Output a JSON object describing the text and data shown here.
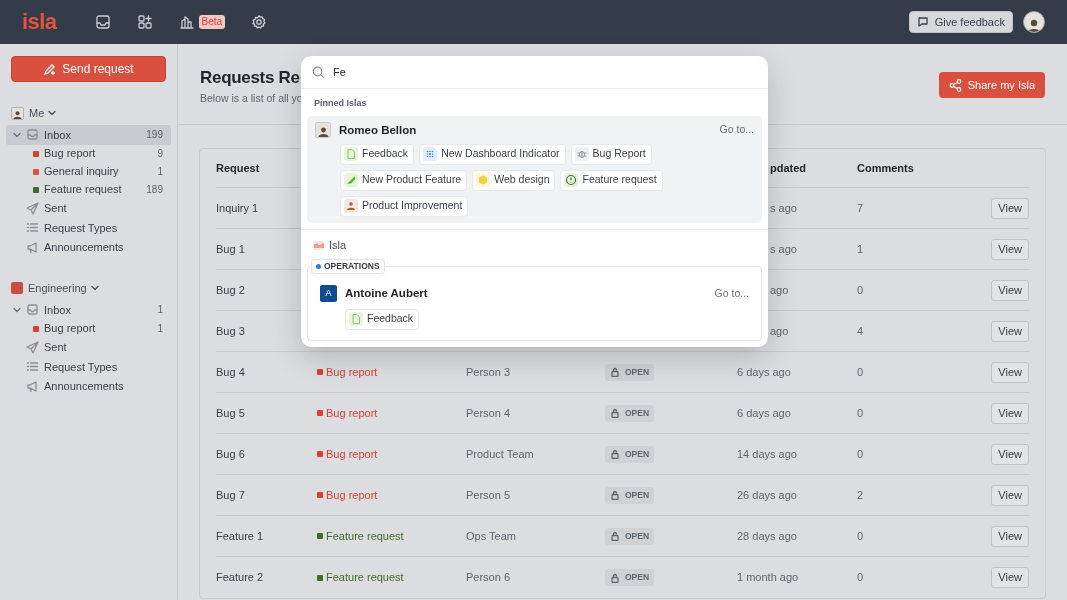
{
  "topbar": {
    "logo": "isla",
    "nav": [
      {
        "kind": "inbox"
      },
      {
        "kind": "apps"
      },
      {
        "kind": "analytics",
        "badge": "Beta"
      },
      {
        "kind": "settings"
      }
    ],
    "feedback_button": "Give feedback"
  },
  "sidebar": {
    "send_button": "Send request",
    "groups": [
      {
        "name": "Me",
        "kind": "person",
        "items": [
          {
            "kind": "inbox",
            "label": "Inbox",
            "count": "199",
            "selected": true,
            "expanded": true,
            "children": [
              {
                "label": "Bug report",
                "count": "9",
                "color": "#d9412f"
              },
              {
                "label": "General inquiry",
                "count": "1",
                "color": "#e2533f"
              },
              {
                "label": "Feature request",
                "count": "189",
                "color": "#3d6e28"
              }
            ]
          },
          {
            "kind": "sent",
            "label": "Sent"
          },
          {
            "kind": "types",
            "label": "Request Types"
          },
          {
            "kind": "announcements",
            "label": "Announcements"
          }
        ]
      },
      {
        "name": "Engineering",
        "kind": "team",
        "color": "#c9503f",
        "items": [
          {
            "kind": "inbox",
            "label": "Inbox",
            "count": "1",
            "selected": false,
            "expanded": true,
            "children": [
              {
                "label": "Bug report",
                "count": "1",
                "color": "#d9412f"
              }
            ]
          },
          {
            "kind": "sent",
            "label": "Sent"
          },
          {
            "kind": "types",
            "label": "Request Types"
          },
          {
            "kind": "announcements",
            "label": "Announcements"
          }
        ]
      }
    ]
  },
  "main": {
    "title": "Requests Re",
    "subtitle": "Below is a list of all yo",
    "share_button": "Share my Isla",
    "table": {
      "header": {
        "request": "Request",
        "updated": "pdated",
        "comments": "Comments"
      },
      "rows": [
        {
          "request": "Inquiry 1",
          "updated": "s ago",
          "comments": "7",
          "action": "View"
        },
        {
          "request": "Bug 1",
          "updated": "s ago",
          "comments": "1",
          "action": "View"
        },
        {
          "request": "Bug 2",
          "updated": "ago",
          "comments": "0",
          "action": "View"
        },
        {
          "request": "Bug 3",
          "updated": "ago",
          "comments": "4",
          "action": "View"
        },
        {
          "request": "Bug 4",
          "type": {
            "label": "Bug report",
            "color": "#d9412f"
          },
          "owner": "Person 3",
          "status": "OPEN",
          "updated": "6 days ago",
          "comments": "0",
          "action": "View"
        },
        {
          "request": "Bug 5",
          "type": {
            "label": "Bug report",
            "color": "#d9412f"
          },
          "owner": "Person 4",
          "status": "OPEN",
          "updated": "6 days ago",
          "comments": "0",
          "action": "View"
        },
        {
          "request": "Bug 6",
          "type": {
            "label": "Bug report",
            "color": "#d9412f"
          },
          "owner": "Product Team",
          "status": "OPEN",
          "updated": "14 days ago",
          "comments": "0",
          "action": "View"
        },
        {
          "request": "Bug 7",
          "type": {
            "label": "Bug report",
            "color": "#d9412f"
          },
          "owner": "Person 5",
          "status": "OPEN",
          "updated": "26 days ago",
          "comments": "2",
          "action": "View"
        },
        {
          "request": "Feature 1",
          "type": {
            "label": "Feature request",
            "color": "#3d6e28"
          },
          "owner": "Ops Team",
          "status": "OPEN",
          "updated": "28 days ago",
          "comments": "0",
          "action": "View"
        },
        {
          "request": "Feature 2",
          "type": {
            "label": "Feature request",
            "color": "#3d6e28"
          },
          "owner": "Person 6",
          "status": "OPEN",
          "updated": "1 month ago",
          "comments": "0",
          "action": "View"
        }
      ]
    }
  },
  "search": {
    "query": "Fe",
    "section": "Pinned Islas",
    "pinned": [
      {
        "name": "Romeo Bellon",
        "goto": "Go to...",
        "selected": true,
        "forms": [
          {
            "label": "Feedback",
            "kind": "doc"
          },
          {
            "label": "New Dashboard Indicator",
            "kind": "grid"
          },
          {
            "label": "Bug Report",
            "kind": "bug"
          },
          {
            "label": "New Product Feature",
            "kind": "pen"
          },
          {
            "label": "Web design",
            "kind": "hex"
          },
          {
            "label": "Feature request",
            "kind": "alert"
          },
          {
            "label": "Product Improvement",
            "kind": "person"
          }
        ]
      }
    ],
    "org": {
      "name": "Isla",
      "team": {
        "label": "OPERATIONS",
        "color": "#2f7be8"
      },
      "people": [
        {
          "name": "Antoine Aubert",
          "initial": "A",
          "goto": "Go to...",
          "selected": false,
          "forms": [
            {
              "label": "Feedback",
              "kind": "doc"
            }
          ]
        }
      ]
    }
  }
}
